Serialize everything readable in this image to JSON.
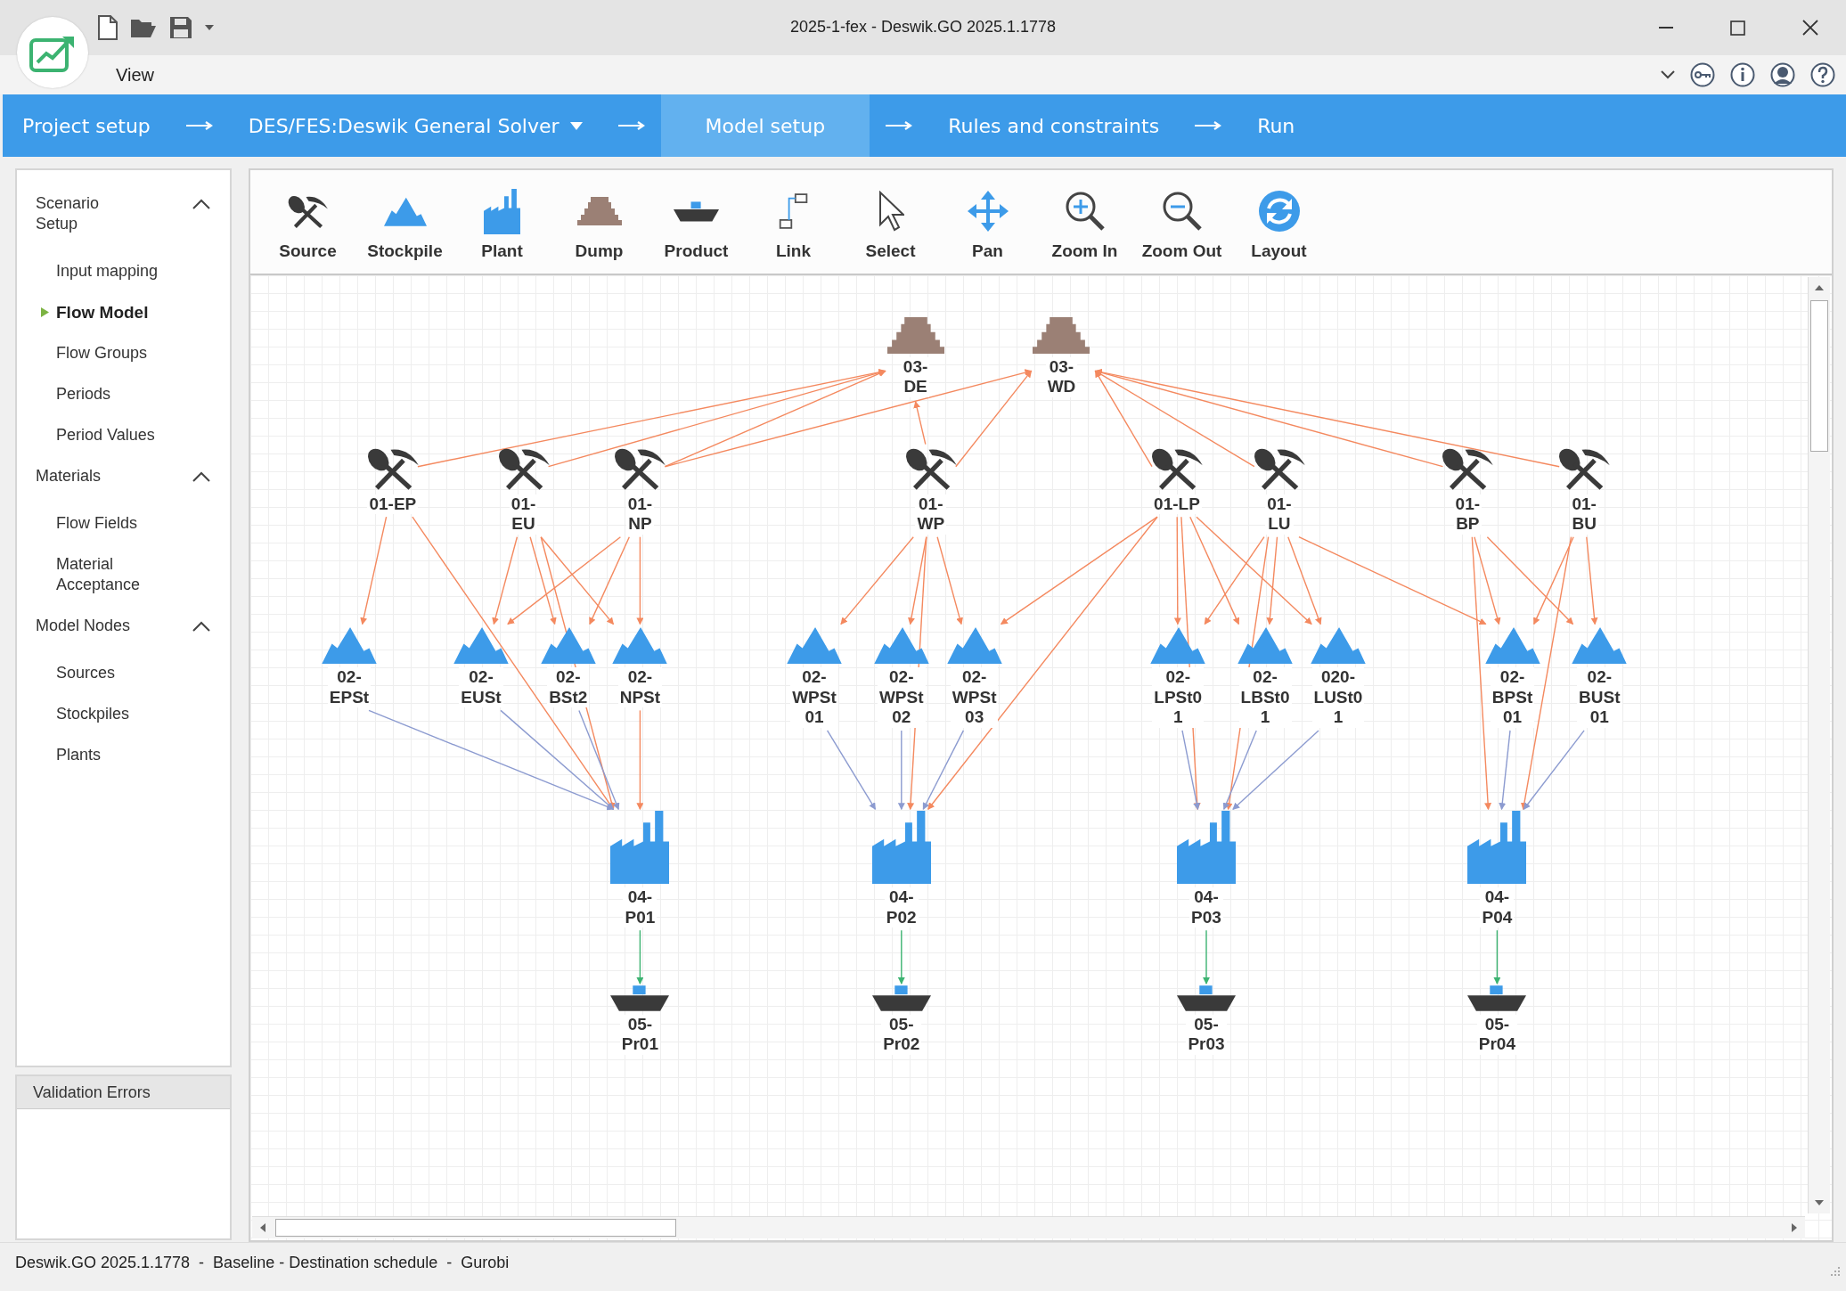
{
  "window": {
    "title": "2025-1-fex - Deswik.GO 2025.1.1778"
  },
  "menu": [
    "View"
  ],
  "workflow": [
    {
      "label": "Project setup",
      "selected": false,
      "dropdown": false
    },
    {
      "label": "DES/FES:Deswik General Solver",
      "selected": false,
      "dropdown": true
    },
    {
      "label": "Model setup",
      "selected": true,
      "dropdown": false
    },
    {
      "label": "Rules and constraints",
      "selected": false,
      "dropdown": false
    },
    {
      "label": "Run",
      "selected": false,
      "dropdown": false
    }
  ],
  "sidebar": {
    "sections": [
      {
        "title": "Scenario\nSetup",
        "expanded": true,
        "items": [
          {
            "label": "Input mapping",
            "selected": false
          },
          {
            "label": "Flow Model",
            "selected": true
          },
          {
            "label": "Flow Groups",
            "selected": false
          },
          {
            "label": "Periods",
            "selected": false
          },
          {
            "label": "Period Values",
            "selected": false
          }
        ]
      },
      {
        "title": "Materials",
        "expanded": true,
        "items": [
          {
            "label": "Flow Fields",
            "selected": false
          },
          {
            "label": "Material\nAcceptance",
            "selected": false
          }
        ]
      },
      {
        "title": "Model Nodes",
        "expanded": true,
        "items": [
          {
            "label": "Sources",
            "selected": false
          },
          {
            "label": "Stockpiles",
            "selected": false
          },
          {
            "label": "Plants",
            "selected": false
          }
        ]
      }
    ]
  },
  "validation": {
    "title": "Validation Errors"
  },
  "toolbar": [
    {
      "label": "Source",
      "kind": "source"
    },
    {
      "label": "Stockpile",
      "kind": "stockpile"
    },
    {
      "label": "Plant",
      "kind": "plant"
    },
    {
      "label": "Dump",
      "kind": "dump"
    },
    {
      "label": "Product",
      "kind": "product"
    },
    {
      "label": "Link",
      "kind": "link"
    },
    {
      "label": "Select",
      "kind": "select"
    },
    {
      "label": "Pan",
      "kind": "pan"
    },
    {
      "label": "Zoom In",
      "kind": "zoom-in"
    },
    {
      "label": "Zoom Out",
      "kind": "zoom-out"
    },
    {
      "label": "Layout",
      "kind": "layout"
    }
  ],
  "nodes": [
    {
      "kind": "dump",
      "label": "03-\nDE"
    },
    {
      "kind": "dump",
      "label": "03-\nWD"
    },
    {
      "kind": "source",
      "label": "01-EP"
    },
    {
      "kind": "source",
      "label": "01-\nEU"
    },
    {
      "kind": "source",
      "label": "01-\nNP"
    },
    {
      "kind": "source",
      "label": "01-\nWP"
    },
    {
      "kind": "source",
      "label": "01-LP"
    },
    {
      "kind": "source",
      "label": "01-\nLU"
    },
    {
      "kind": "source",
      "label": "01-\nBP"
    },
    {
      "kind": "source",
      "label": "01-\nBU"
    },
    {
      "kind": "stockpile",
      "label": "02-\nEPSt"
    },
    {
      "kind": "stockpile",
      "label": "02-\nEUSt"
    },
    {
      "kind": "stockpile",
      "label": "02-\nBSt2"
    },
    {
      "kind": "stockpile",
      "label": "02-\nNPSt"
    },
    {
      "kind": "stockpile",
      "label": "02-\nWPSt\n01"
    },
    {
      "kind": "stockpile",
      "label": "02-\nWPSt\n02"
    },
    {
      "kind": "stockpile",
      "label": "02-\nWPSt\n03"
    },
    {
      "kind": "stockpile",
      "label": "02-\nLPSt0\n1"
    },
    {
      "kind": "stockpile",
      "label": "02-\nLBSt0\n1"
    },
    {
      "kind": "stockpile",
      "label": "020-\nLUSt0\n1"
    },
    {
      "kind": "stockpile",
      "label": "02-\nBPSt\n01"
    },
    {
      "kind": "stockpile",
      "label": "02-\nBUSt\n01"
    },
    {
      "kind": "plant",
      "label": "04-\nP01"
    },
    {
      "kind": "plant",
      "label": "04-\nP02"
    },
    {
      "kind": "plant",
      "label": "04-\nP03"
    },
    {
      "kind": "plant",
      "label": "04-\nP04"
    },
    {
      "kind": "product",
      "label": "05-\nPr01"
    },
    {
      "kind": "product",
      "label": "05-\nPr02"
    },
    {
      "kind": "product",
      "label": "05-\nPr03"
    },
    {
      "kind": "product",
      "label": "05-\nPr04"
    }
  ],
  "status_bar": "Deswik.GO 2025.1.1778  -  Baseline - Destination schedule  -  Gurobi"
}
